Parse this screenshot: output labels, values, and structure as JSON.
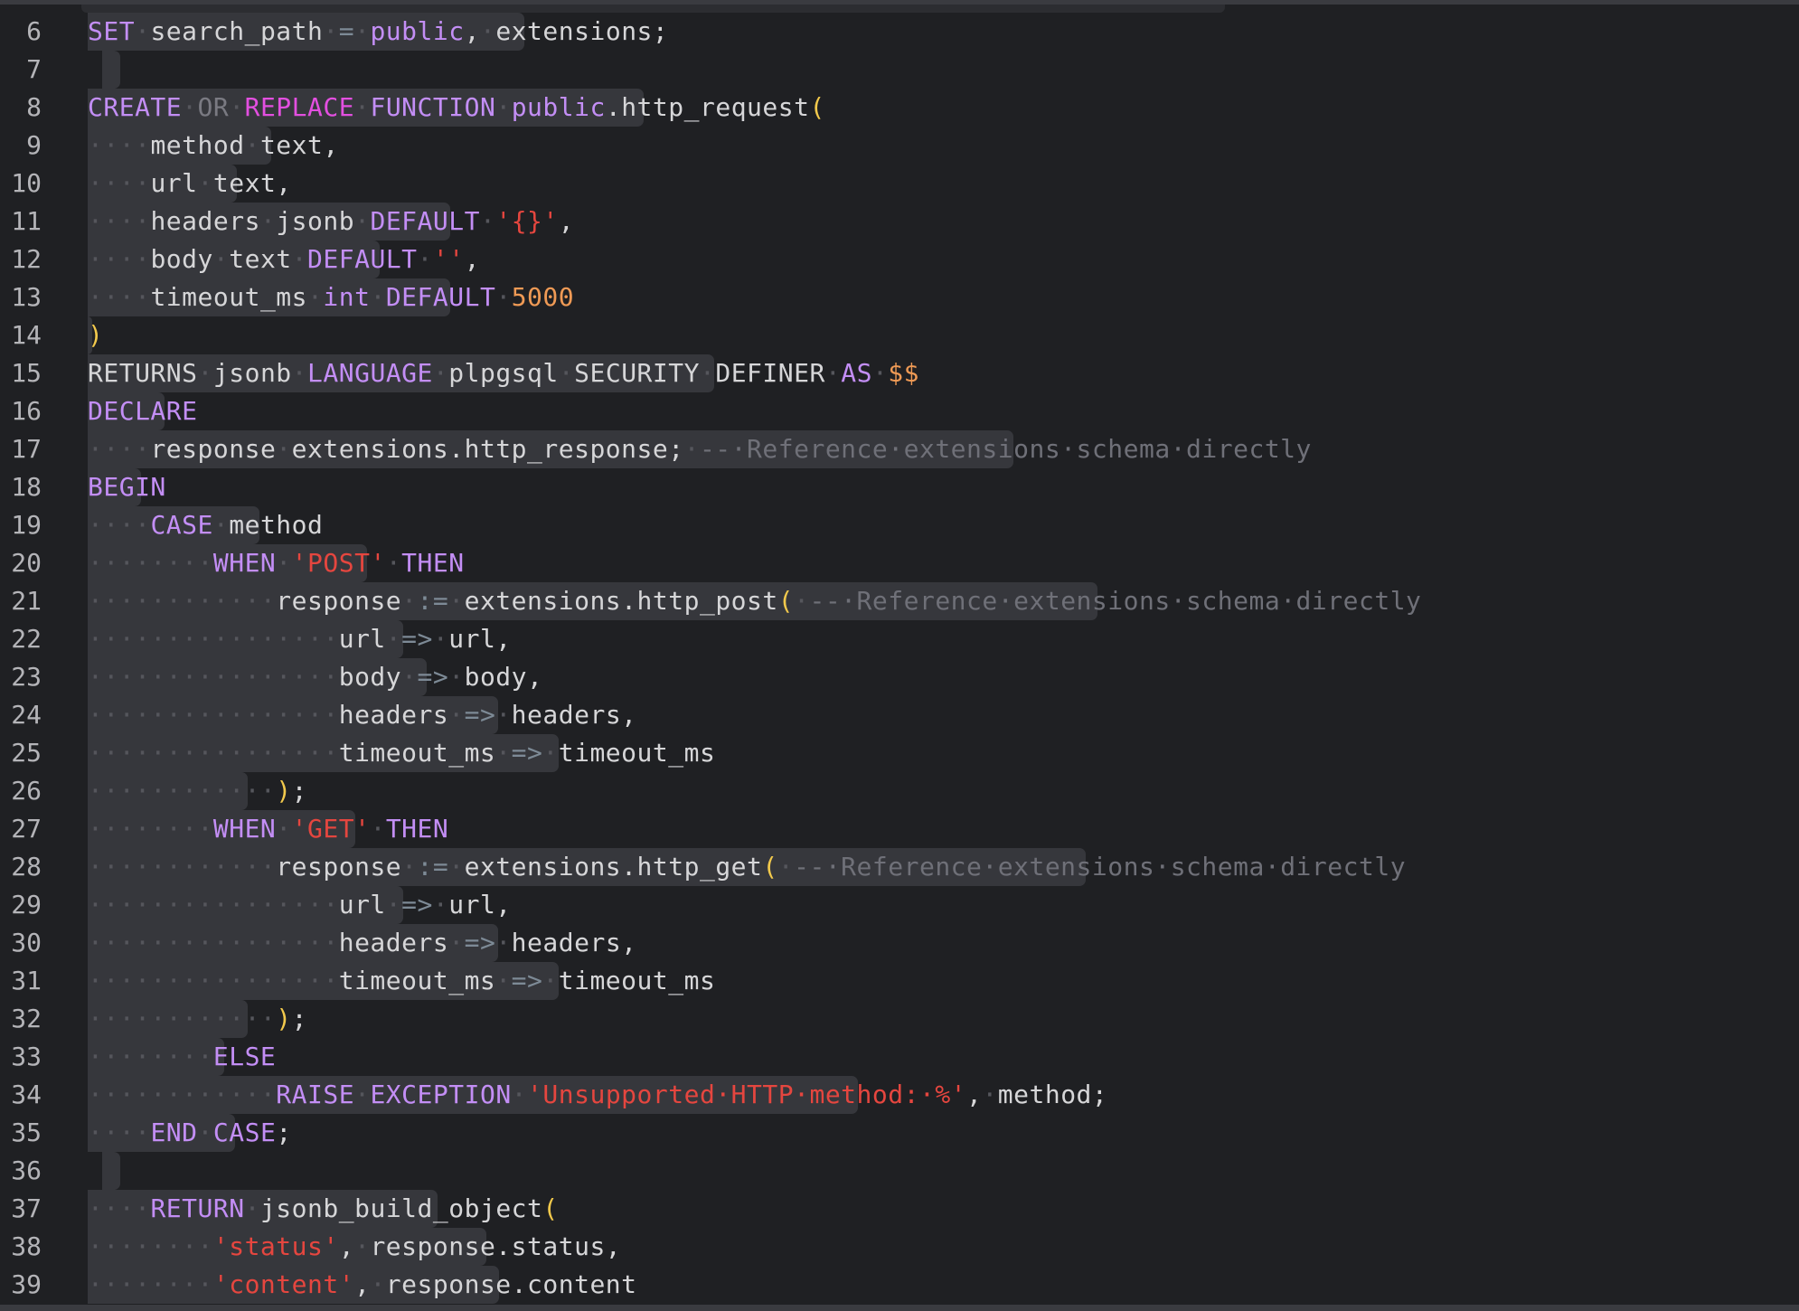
{
  "editor": {
    "language": "plpgsql",
    "lines": [
      {
        "n": "6",
        "sel": 580
      },
      {
        "n": "7",
        "sel": 0
      },
      {
        "n": "8",
        "sel": 712
      },
      {
        "n": "9",
        "sel": 300
      },
      {
        "n": "10",
        "sel": 262
      },
      {
        "n": "11",
        "sel": 498
      },
      {
        "n": "12",
        "sel": 420
      },
      {
        "n": "13",
        "sel": 498
      },
      {
        "n": "14",
        "sel": 102
      },
      {
        "n": "15",
        "sel": 790
      },
      {
        "n": "16",
        "sel": 182
      },
      {
        "n": "17",
        "sel": 1121
      },
      {
        "n": "18",
        "sel": 156
      },
      {
        "n": "19",
        "sel": 287
      },
      {
        "n": "20",
        "sel": 406
      },
      {
        "n": "21",
        "sel": 1214
      },
      {
        "n": "22",
        "sel": 446
      },
      {
        "n": "23",
        "sel": 472
      },
      {
        "n": "24",
        "sel": 551
      },
      {
        "n": "25",
        "sel": 618
      },
      {
        "n": "26",
        "sel": 274
      },
      {
        "n": "27",
        "sel": 393
      },
      {
        "n": "28",
        "sel": 1201
      },
      {
        "n": "29",
        "sel": 446
      },
      {
        "n": "30",
        "sel": 551
      },
      {
        "n": "31",
        "sel": 618
      },
      {
        "n": "32",
        "sel": 274
      },
      {
        "n": "33",
        "sel": 248
      },
      {
        "n": "34",
        "sel": 949
      },
      {
        "n": "35",
        "sel": 260
      },
      {
        "n": "36",
        "sel": 0
      },
      {
        "n": "37",
        "sel": 484
      },
      {
        "n": "38",
        "sel": 538
      },
      {
        "n": "39",
        "sel": 552
      }
    ],
    "code": [
      [
        [
          "k1",
          "SET"
        ],
        [
          "ws",
          "·"
        ],
        [
          "id",
          "search_path"
        ],
        [
          "ws",
          "·"
        ],
        [
          "ar",
          "="
        ],
        [
          "ws",
          "·"
        ],
        [
          "k1",
          "public"
        ],
        [
          "id",
          ","
        ],
        [
          "ws",
          "·"
        ],
        [
          "id",
          "extensions;"
        ]
      ],
      [],
      [
        [
          "k1",
          "CREATE"
        ],
        [
          "ws",
          "·"
        ],
        [
          "op",
          "OR"
        ],
        [
          "ws",
          "·"
        ],
        [
          "k2",
          "REPLACE"
        ],
        [
          "ws",
          "·"
        ],
        [
          "k1",
          "FUNCTION"
        ],
        [
          "ws",
          "·"
        ],
        [
          "k1",
          "public"
        ],
        [
          "id",
          ".http_request"
        ],
        [
          "br",
          "("
        ]
      ],
      [
        [
          "ws",
          "····"
        ],
        [
          "id",
          "method"
        ],
        [
          "ws",
          "·"
        ],
        [
          "id",
          "text,"
        ]
      ],
      [
        [
          "ws",
          "····"
        ],
        [
          "id",
          "url"
        ],
        [
          "ws",
          "·"
        ],
        [
          "id",
          "text,"
        ]
      ],
      [
        [
          "ws",
          "····"
        ],
        [
          "id",
          "headers"
        ],
        [
          "ws",
          "·"
        ],
        [
          "id",
          "jsonb"
        ],
        [
          "ws",
          "·"
        ],
        [
          "k1",
          "DEFAULT"
        ],
        [
          "ws",
          "·"
        ],
        [
          "st",
          "'{}'"
        ],
        [
          "id",
          ","
        ]
      ],
      [
        [
          "ws",
          "····"
        ],
        [
          "id",
          "body"
        ],
        [
          "ws",
          "·"
        ],
        [
          "id",
          "text"
        ],
        [
          "ws",
          "·"
        ],
        [
          "k1",
          "DEFAULT"
        ],
        [
          "ws",
          "·"
        ],
        [
          "st",
          "''"
        ],
        [
          "id",
          ","
        ]
      ],
      [
        [
          "ws",
          "····"
        ],
        [
          "id",
          "timeout_ms"
        ],
        [
          "ws",
          "·"
        ],
        [
          "k1",
          "int"
        ],
        [
          "ws",
          "·"
        ],
        [
          "k1",
          "DEFAULT"
        ],
        [
          "ws",
          "·"
        ],
        [
          "nm",
          "5000"
        ]
      ],
      [
        [
          "br",
          ")"
        ]
      ],
      [
        [
          "id",
          "RETURNS"
        ],
        [
          "ws",
          "·"
        ],
        [
          "id",
          "jsonb"
        ],
        [
          "ws",
          "·"
        ],
        [
          "k1",
          "LANGUAGE"
        ],
        [
          "ws",
          "·"
        ],
        [
          "id",
          "plpgsql"
        ],
        [
          "ws",
          "·"
        ],
        [
          "id",
          "SECURITY"
        ],
        [
          "ws",
          "·"
        ],
        [
          "id",
          "DEFINER"
        ],
        [
          "ws",
          "·"
        ],
        [
          "k1",
          "AS"
        ],
        [
          "ws",
          "·"
        ],
        [
          "nm",
          "$$"
        ]
      ],
      [
        [
          "k1",
          "DECLARE"
        ]
      ],
      [
        [
          "ws",
          "····"
        ],
        [
          "id",
          "response"
        ],
        [
          "ws",
          "·"
        ],
        [
          "id",
          "extensions.http_response;"
        ],
        [
          "ws",
          "·"
        ],
        [
          "cm",
          "--·Reference·extensions·schema·directly"
        ]
      ],
      [
        [
          "k1",
          "BEGIN"
        ]
      ],
      [
        [
          "ws",
          "····"
        ],
        [
          "k1",
          "CASE"
        ],
        [
          "ws",
          "·"
        ],
        [
          "id",
          "method"
        ]
      ],
      [
        [
          "ws",
          "········"
        ],
        [
          "k1",
          "WHEN"
        ],
        [
          "ws",
          "·"
        ],
        [
          "st",
          "'POST'"
        ],
        [
          "ws",
          "·"
        ],
        [
          "k1",
          "THEN"
        ]
      ],
      [
        [
          "ws",
          "············"
        ],
        [
          "id",
          "response"
        ],
        [
          "ws",
          "·"
        ],
        [
          "ar",
          ":="
        ],
        [
          "ws",
          "·"
        ],
        [
          "id",
          "extensions.http_post"
        ],
        [
          "br",
          "("
        ],
        [
          "ws",
          "·"
        ],
        [
          "cm",
          "--·Reference·extensions·schema·directly"
        ]
      ],
      [
        [
          "ws",
          "················"
        ],
        [
          "id",
          "url"
        ],
        [
          "ws",
          "·"
        ],
        [
          "ar",
          "=>"
        ],
        [
          "ws",
          "·"
        ],
        [
          "id",
          "url,"
        ]
      ],
      [
        [
          "ws",
          "················"
        ],
        [
          "id",
          "body"
        ],
        [
          "ws",
          "·"
        ],
        [
          "ar",
          "=>"
        ],
        [
          "ws",
          "·"
        ],
        [
          "id",
          "body,"
        ]
      ],
      [
        [
          "ws",
          "················"
        ],
        [
          "id",
          "headers"
        ],
        [
          "ws",
          "·"
        ],
        [
          "ar",
          "=>"
        ],
        [
          "ws",
          "·"
        ],
        [
          "id",
          "headers,"
        ]
      ],
      [
        [
          "ws",
          "················"
        ],
        [
          "id",
          "timeout_ms"
        ],
        [
          "ws",
          "·"
        ],
        [
          "ar",
          "=>"
        ],
        [
          "ws",
          "·"
        ],
        [
          "id",
          "timeout_ms"
        ]
      ],
      [
        [
          "ws",
          "············"
        ],
        [
          "br",
          ")"
        ],
        [
          "id",
          ";"
        ]
      ],
      [
        [
          "ws",
          "········"
        ],
        [
          "k1",
          "WHEN"
        ],
        [
          "ws",
          "·"
        ],
        [
          "st",
          "'GET'"
        ],
        [
          "ws",
          "·"
        ],
        [
          "k1",
          "THEN"
        ]
      ],
      [
        [
          "ws",
          "············"
        ],
        [
          "id",
          "response"
        ],
        [
          "ws",
          "·"
        ],
        [
          "ar",
          ":="
        ],
        [
          "ws",
          "·"
        ],
        [
          "id",
          "extensions.http_get"
        ],
        [
          "br",
          "("
        ],
        [
          "ws",
          "·"
        ],
        [
          "cm",
          "--·Reference·extensions·schema·directly"
        ]
      ],
      [
        [
          "ws",
          "················"
        ],
        [
          "id",
          "url"
        ],
        [
          "ws",
          "·"
        ],
        [
          "ar",
          "=>"
        ],
        [
          "ws",
          "·"
        ],
        [
          "id",
          "url,"
        ]
      ],
      [
        [
          "ws",
          "················"
        ],
        [
          "id",
          "headers"
        ],
        [
          "ws",
          "·"
        ],
        [
          "ar",
          "=>"
        ],
        [
          "ws",
          "·"
        ],
        [
          "id",
          "headers,"
        ]
      ],
      [
        [
          "ws",
          "················"
        ],
        [
          "id",
          "timeout_ms"
        ],
        [
          "ws",
          "·"
        ],
        [
          "ar",
          "=>"
        ],
        [
          "ws",
          "·"
        ],
        [
          "id",
          "timeout_ms"
        ]
      ],
      [
        [
          "ws",
          "············"
        ],
        [
          "br",
          ")"
        ],
        [
          "id",
          ";"
        ]
      ],
      [
        [
          "ws",
          "········"
        ],
        [
          "k1",
          "ELSE"
        ]
      ],
      [
        [
          "ws",
          "············"
        ],
        [
          "k1",
          "RAISE"
        ],
        [
          "ws",
          "·"
        ],
        [
          "k1",
          "EXCEPTION"
        ],
        [
          "ws",
          "·"
        ],
        [
          "st",
          "'Unsupported·HTTP·method:·%'"
        ],
        [
          "id",
          ","
        ],
        [
          "ws",
          "·"
        ],
        [
          "id",
          "method;"
        ]
      ],
      [
        [
          "ws",
          "····"
        ],
        [
          "k1",
          "END"
        ],
        [
          "ws",
          "·"
        ],
        [
          "k1",
          "CASE"
        ],
        [
          "id",
          ";"
        ]
      ],
      [],
      [
        [
          "ws",
          "····"
        ],
        [
          "k1",
          "RETURN"
        ],
        [
          "ws",
          "·"
        ],
        [
          "id",
          "jsonb_build_object"
        ],
        [
          "br",
          "("
        ]
      ],
      [
        [
          "ws",
          "········"
        ],
        [
          "st",
          "'status'"
        ],
        [
          "id",
          ","
        ],
        [
          "ws",
          "·"
        ],
        [
          "id",
          "response.status,"
        ]
      ],
      [
        [
          "ws",
          "········"
        ],
        [
          "st",
          "'content'"
        ],
        [
          "id",
          ","
        ],
        [
          "ws",
          "·"
        ],
        [
          "id",
          "response.content"
        ]
      ]
    ]
  }
}
